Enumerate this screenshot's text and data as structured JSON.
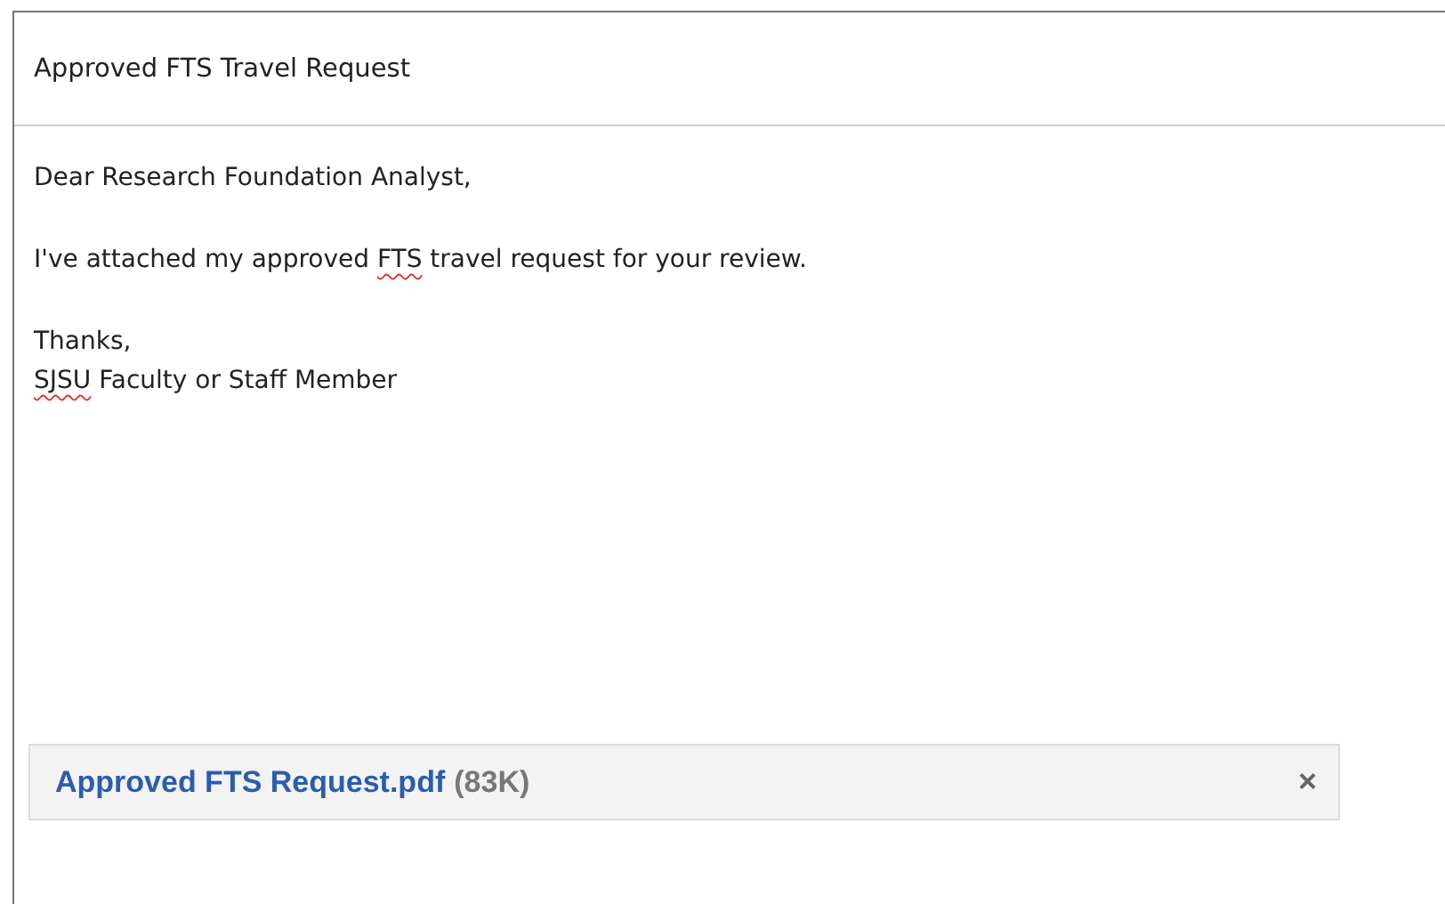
{
  "subject": "Approved FTS Travel Request",
  "body": [
    {
      "lines": [
        [
          {
            "text": "Dear Research Foundation Analyst,",
            "misspelled": false
          }
        ]
      ]
    },
    {
      "lines": [
        [
          {
            "text": "I've attached my approved ",
            "misspelled": false
          },
          {
            "text": "FTS",
            "misspelled": true
          },
          {
            "text": " travel request for your review.",
            "misspelled": false
          }
        ]
      ]
    },
    {
      "lines": [
        [
          {
            "text": "Thanks,",
            "misspelled": false
          }
        ],
        [
          {
            "text": "SJSU",
            "misspelled": true
          },
          {
            "text": " Faculty or Staff Member",
            "misspelled": false
          }
        ]
      ]
    }
  ],
  "attachment": {
    "name": "Approved FTS Request.pdf",
    "size": "(83K)",
    "remove": "×"
  }
}
